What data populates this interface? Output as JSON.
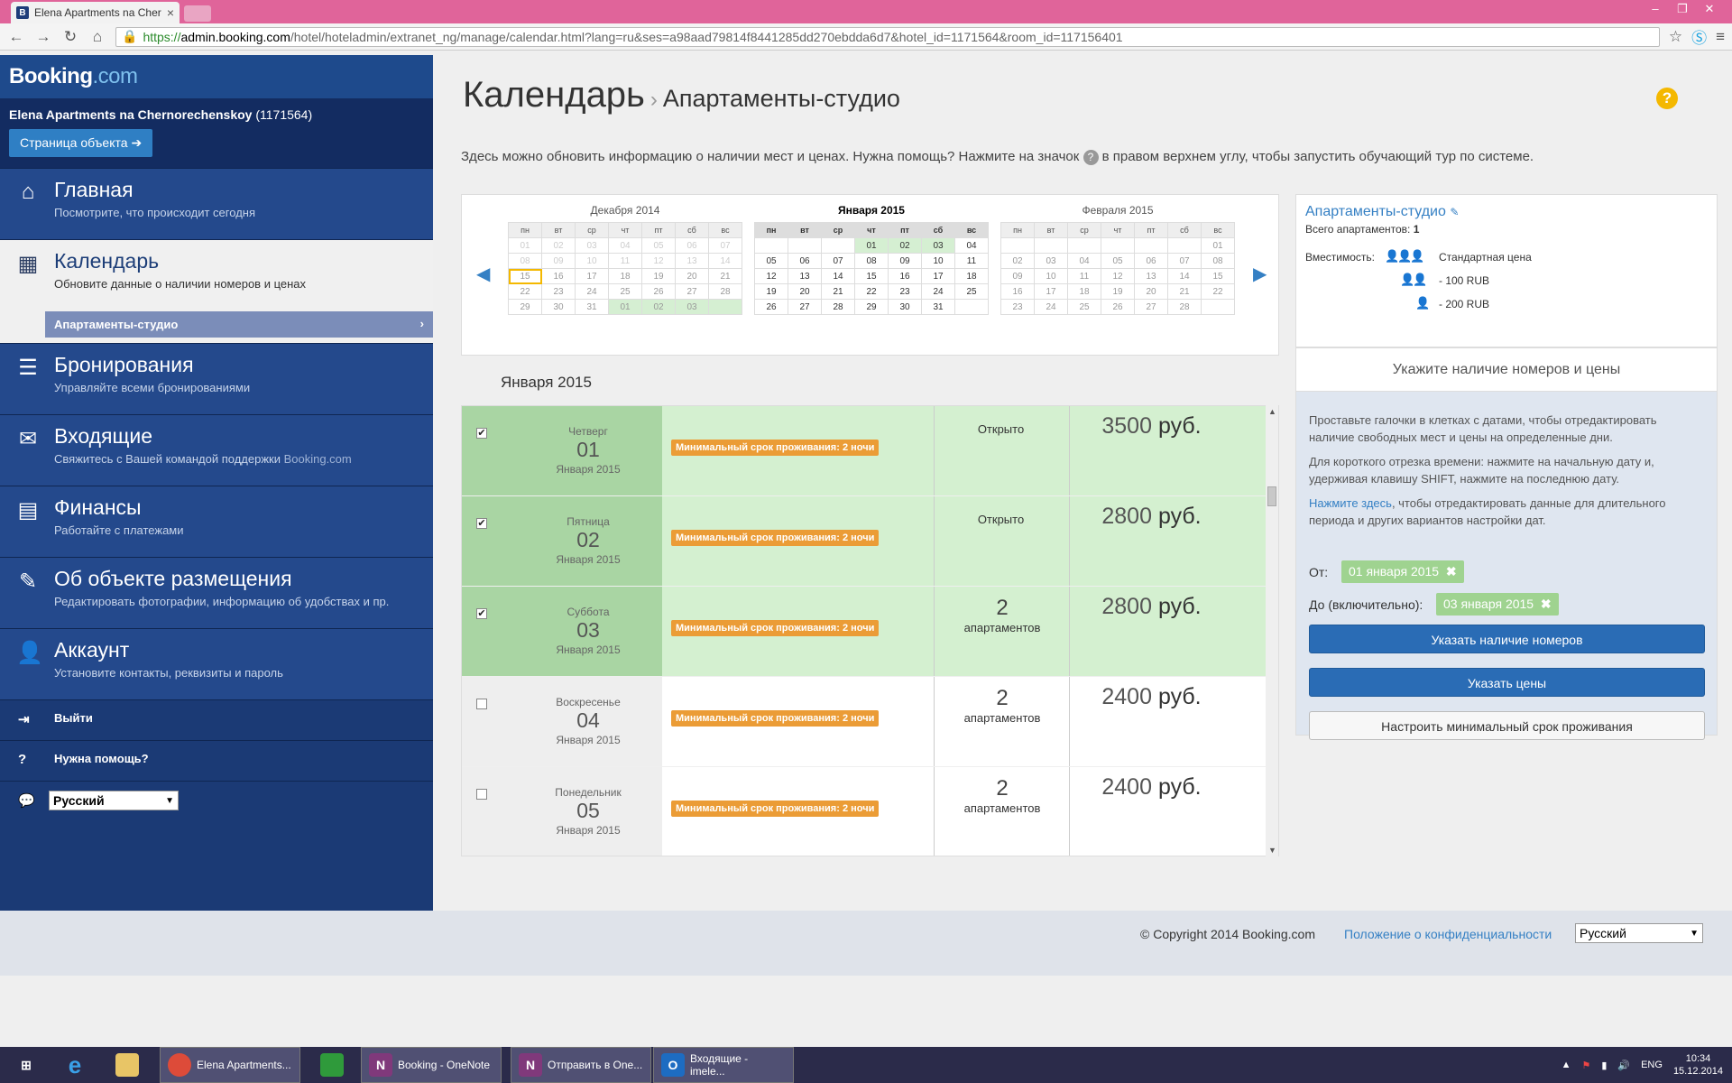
{
  "browser": {
    "tab_title": "Elena Apartments na Cher",
    "tab_icon_letter": "B",
    "url_https": "https://",
    "url_host": "admin.booking.com",
    "url_path": "/hotel/hoteladmin/extranet_ng/manage/calendar.html?lang=ru&ses=a98aad79814f8441285dd270ebdda6d7&hotel_id=1171564&room_id=117156401"
  },
  "sidebar": {
    "logo_main": "Booking",
    "logo_dot": ".com",
    "property_name": "Elena Apartments na Chernorechenskoy",
    "property_id": "(1171564)",
    "property_button": "Страница объекта",
    "nav": [
      {
        "title": "Главная",
        "desc": "Посмотрите, что происходит сегодня",
        "icon": "home-icon"
      },
      {
        "title": "Календарь",
        "desc": "Обновите данные о наличии номеров и ценах",
        "icon": "calendar-icon"
      },
      {
        "title": "Бронирования",
        "desc": "Управляйте всеми бронированиями",
        "icon": "list-icon"
      },
      {
        "title": "Входящие",
        "desc": "Свяжитесь с Вашей командой поддержки ",
        "desc_suffix": "Booking.com",
        "icon": "envelope-icon"
      },
      {
        "title": "Финансы",
        "desc": "Работайте с платежами",
        "icon": "ledger-icon"
      },
      {
        "title": "Об объекте размещения",
        "desc": "Редактировать фотографии, информацию об удобствах и пр.",
        "icon": "pencil-icon"
      },
      {
        "title": "Аккаунт",
        "desc": "Установите контакты, реквизиты и пароль",
        "icon": "user-icon"
      }
    ],
    "subnav_item": "Апартаменты-студио",
    "logout": "Выйти",
    "help": "Нужна помощь?",
    "language": "Русский"
  },
  "header": {
    "title": "Календарь",
    "subtitle": "Апартаменты-студио",
    "intro_before": "Здесь можно обновить информацию о наличии мест и ценах. Нужна помощь? Нажмите на значок",
    "intro_after": "в правом верхнем углу, чтобы запустить обучающий тур по системе."
  },
  "mini_calendars": [
    {
      "month": "Декабря 2014",
      "current": false,
      "days": [
        "01",
        "02",
        "03",
        "04",
        "05",
        "06",
        "07",
        "08",
        "09",
        "10",
        "11",
        "12",
        "13",
        "14",
        "15",
        "16",
        "17",
        "18",
        "19",
        "20",
        "21",
        "22",
        "23",
        "24",
        "25",
        "26",
        "27",
        "28",
        "29",
        "30",
        "31",
        "01",
        "02",
        "03",
        ""
      ]
    },
    {
      "month": "Января 2015",
      "current": true,
      "days": [
        "",
        "",
        "",
        "01",
        "02",
        "03",
        "04",
        "05",
        "06",
        "07",
        "08",
        "09",
        "10",
        "11",
        "12",
        "13",
        "14",
        "15",
        "16",
        "17",
        "18",
        "19",
        "20",
        "21",
        "22",
        "23",
        "24",
        "25",
        "26",
        "27",
        "28",
        "29",
        "30",
        "31",
        ""
      ]
    },
    {
      "month": "Февраля 2015",
      "current": false,
      "days": [
        "",
        "",
        "",
        "",
        "",
        "",
        "01",
        "02",
        "03",
        "04",
        "05",
        "06",
        "07",
        "08",
        "09",
        "10",
        "11",
        "12",
        "13",
        "14",
        "15",
        "16",
        "17",
        "18",
        "19",
        "20",
        "21",
        "22",
        "23",
        "24",
        "25",
        "26",
        "27",
        "28",
        ""
      ]
    }
  ],
  "weekdays": [
    "пн",
    "вт",
    "ср",
    "чт",
    "пт",
    "сб",
    "вс"
  ],
  "month_title": "Января 2015",
  "rows": [
    {
      "checked": true,
      "weekday": "Четверг",
      "day": "01",
      "month": "Января 2015",
      "min_stay": "Минимальный срок проживания: 2 ночи",
      "status": "Открыто",
      "count": "",
      "count_label": "",
      "price": "3500",
      "currency": "руб."
    },
    {
      "checked": true,
      "weekday": "Пятница",
      "day": "02",
      "month": "Января 2015",
      "min_stay": "Минимальный срок проживания: 2 ночи",
      "status": "Открыто",
      "count": "",
      "count_label": "",
      "price": "2800",
      "currency": "руб."
    },
    {
      "checked": true,
      "weekday": "Суббота",
      "day": "03",
      "month": "Января 2015",
      "min_stay": "Минимальный срок проживания: 2 ночи",
      "status": "",
      "count": "2",
      "count_label": "апартаментов",
      "price": "2800",
      "currency": "руб."
    },
    {
      "checked": false,
      "weekday": "Воскресенье",
      "day": "04",
      "month": "Января 2015",
      "min_stay": "Минимальный срок проживания: 2 ночи",
      "status": "",
      "count": "2",
      "count_label": "апартаментов",
      "price": "2400",
      "currency": "руб."
    },
    {
      "checked": false,
      "weekday": "Понедельник",
      "day": "05",
      "month": "Января 2015",
      "min_stay": "Минимальный срок проживания: 2 ночи",
      "status": "",
      "count": "2",
      "count_label": "апартаментов",
      "price": "2400",
      "currency": "руб."
    }
  ],
  "room_panel": {
    "title": "Апартаменты-студио",
    "total_label": "Всего апартаментов:",
    "total_value": "1",
    "capacity_label": "Вместимость:",
    "standard_price": "Стандартная цена",
    "minus100": "- 100 RUB",
    "minus200": "- 200 RUB"
  },
  "edit_panel": {
    "header": "Укажите наличие номеров и цены",
    "p1": "Проставьте галочки в клетках с датами, чтобы отредактировать наличие свободных мест и цены на определенные дни.",
    "p2": "Для короткого отрезка времени: нажмите на начальную дату и, удерживая клавишу SHIFT, нажмите на последнюю дату.",
    "p3_link": "Нажмите здесь",
    "p3_rest": ", чтобы отредактировать данные для длительного периода и других вариантов настройки дат.",
    "from_label": "От:",
    "from_value": "01 января 2015",
    "to_label": "До (включительно):",
    "to_value": "03 января 2015",
    "btn_availability": "Указать наличие номеров",
    "btn_prices": "Указать цены",
    "btn_minstay": "Настроить минимальный срок проживания"
  },
  "footer": {
    "copyright": "© Copyright 2014 Booking.com",
    "privacy": "Положение о конфиденциальности",
    "language": "Русский"
  },
  "taskbar": {
    "items": [
      {
        "label": "Elena Apartments...",
        "icon": "chrome-icon"
      },
      {
        "label": "",
        "icon": "store-icon"
      },
      {
        "label": "Booking - OneNote",
        "icon": "onenote-icon"
      },
      {
        "label": "Отправить в One...",
        "icon": "onenote-clip-icon"
      },
      {
        "label": "Входящие - imele...",
        "icon": "outlook-icon"
      }
    ],
    "lang": "ENG",
    "time": "10:34",
    "date": "15.12.2014"
  },
  "colors": {
    "brand": "#1b3a75",
    "accent": "#3580c4",
    "selected_row": "#d4f0d0",
    "badge": "#eb9c36",
    "help": "#f4b800"
  }
}
